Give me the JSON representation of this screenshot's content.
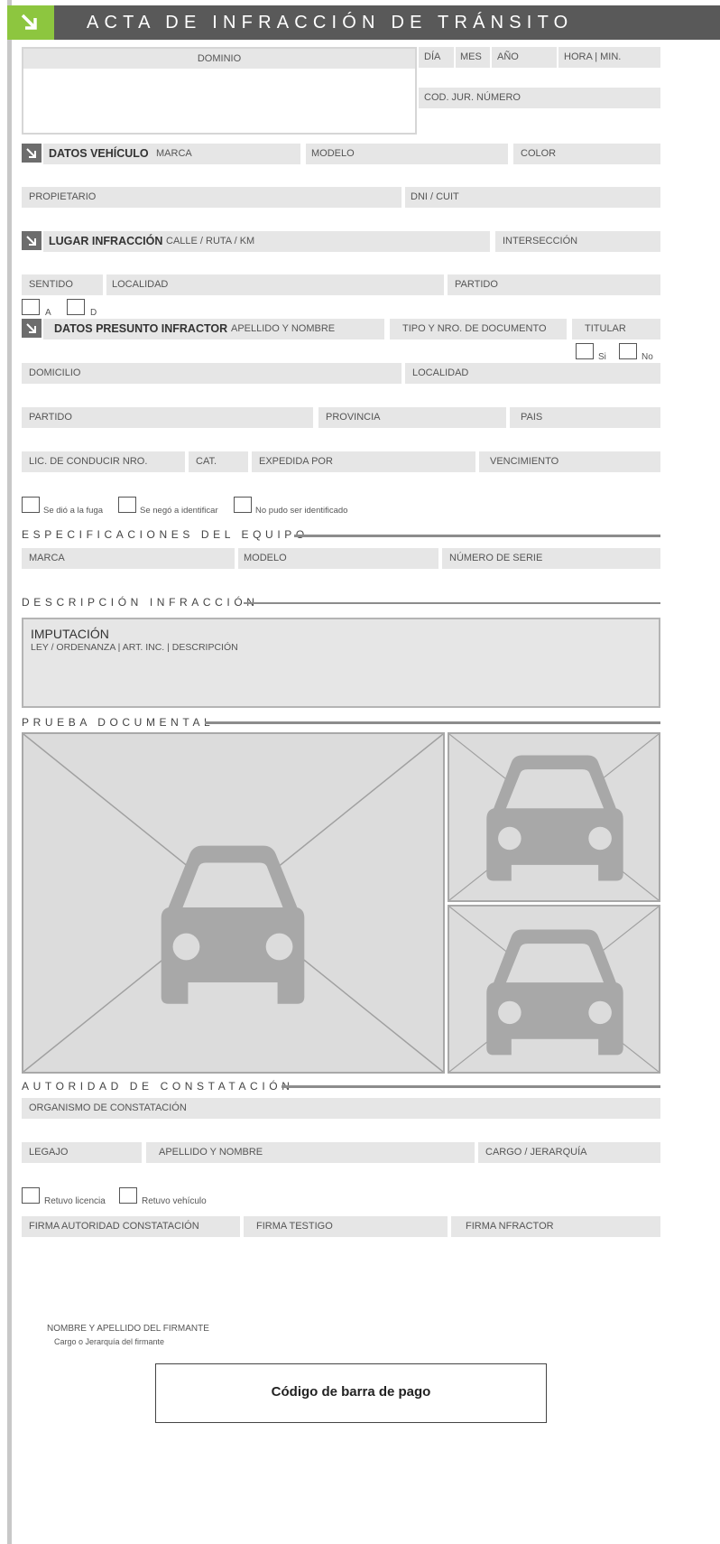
{
  "header": {
    "title": "ACTA DE INFRACCIÓN DE TRÁNSITO"
  },
  "top": {
    "dominio": "DOMINIO",
    "dia": "DÍA",
    "mes": "MES",
    "anio": "AÑO",
    "hora": "HORA | MIN.",
    "cod_jur": "COD. JUR. NÚMERO"
  },
  "vehiculo": {
    "title": "DATOS VEHÍCULO",
    "marca": "MARCA",
    "modelo": "MODELO",
    "color": "COLOR",
    "propietario": "PROPIETARIO",
    "dni": "DNI / CUIT"
  },
  "lugar": {
    "title": "LUGAR INFRACCIÓN",
    "calle": "CALLE / RUTA / KM",
    "interseccion": "INTERSECCIÓN",
    "sentido": "SENTIDO",
    "localidad": "LOCALIDAD",
    "partido": "PARTIDO",
    "a": "A",
    "d": "D"
  },
  "infractor": {
    "title": "DATOS PRESUNTO INFRACTOR",
    "apellido": "APELLIDO Y NOMBRE",
    "tipo_doc": "TIPO Y NRO. DE DOCUMENTO",
    "titular": "TITULAR",
    "si": "Si",
    "no": "No",
    "domicilio": "DOMICILIO",
    "localidad": "LOCALIDAD",
    "partido": "PARTIDO",
    "provincia": "PROVINCIA",
    "pais": "PAIS",
    "licencia": "LIC. DE CONDUCIR NRO.",
    "cat": "CAT.",
    "expedida": "EXPEDIDA POR",
    "vencimiento": "VENCIMIENTO",
    "fuga": "Se dió a la fuga",
    "nego": "Se negó a identificar",
    "no_pudo": "No pudo ser identificado"
  },
  "equipo": {
    "title": "ESPECIFICACIONES DEL EQUIPO",
    "marca": "MARCA",
    "modelo": "MODELO",
    "serie": "NÚMERO DE SERIE"
  },
  "descripcion": {
    "title": "DESCRIPCIÓN INFRACCIÓN",
    "imputacion": "IMPUTACIÓN",
    "detalle": "LEY / ORDENANZA | ART. INC. | DESCRIPCIÓN"
  },
  "prueba": {
    "title": "PRUEBA DOCUMENTAL",
    "icon": "car-icon"
  },
  "autoridad": {
    "title": "AUTORIDAD DE CONSTATACIÓN",
    "organismo": "ORGANISMO DE CONSTATACIÓN",
    "legajo": "LEGAJO",
    "apellido": "APELLIDO Y NOMBRE",
    "cargo": "CARGO / JERARQUÍA",
    "retuvo_licencia": "Retuvo licencia",
    "retuvo_vehiculo": "Retuvo vehículo",
    "firma_autoridad": "FIRMA AUTORIDAD CONSTATACIÓN",
    "firma_testigo": "FIRMA TESTIGO",
    "firma_infractor": "FIRMA NFRACTOR"
  },
  "firmante": {
    "nombre": "NOMBRE Y APELLIDO DEL FIRMANTE",
    "cargo": "Cargo o Jerarquía del firmante"
  },
  "barcode": {
    "label": "Código de barra de pago"
  },
  "colors": {
    "accent": "#8dc63f",
    "header": "#595959",
    "field": "#e6e6e6"
  }
}
